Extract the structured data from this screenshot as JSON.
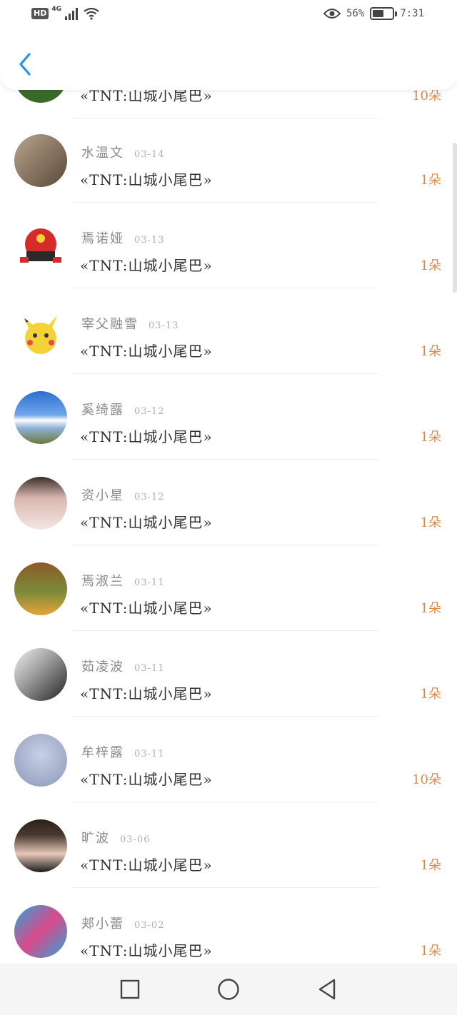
{
  "status_bar": {
    "hd": "HD",
    "network": "4G",
    "battery_pct": "56%",
    "battery_level": 0.56,
    "time": "7:31"
  },
  "nav": {
    "back_icon": "chevron-left-icon",
    "accent": "#2196f3"
  },
  "accent_count_color": "#e08a4a",
  "rows": [
    {
      "name": "",
      "date": "",
      "title": "«TNT:山城小尾巴»",
      "count": "10朵",
      "avatar_bg": "#3a6a2a"
    },
    {
      "name": "水温文",
      "date": "03-14",
      "title": "«TNT:山城小尾巴»",
      "count": "1朵",
      "avatar_bg": "#7a6a5a"
    },
    {
      "name": "焉诺娅",
      "date": "03-13",
      "title": "«TNT:山城小尾巴»",
      "count": "1朵",
      "avatar_bg": "#d62b2b"
    },
    {
      "name": "宰父融雪",
      "date": "03-13",
      "title": "«TNT:山城小尾巴»",
      "count": "1朵",
      "avatar_bg": "#f3d23a"
    },
    {
      "name": "奚绮露",
      "date": "03-12",
      "title": "«TNT:山城小尾巴»",
      "count": "1朵",
      "avatar_bg": "#3d78c9"
    },
    {
      "name": "资小星",
      "date": "03-12",
      "title": "«TNT:山城小尾巴»",
      "count": "1朵",
      "avatar_bg": "#d9b7b0"
    },
    {
      "name": "焉淑兰",
      "date": "03-11",
      "title": "«TNT:山城小尾巴»",
      "count": "1朵",
      "avatar_bg": "#7b8a3a"
    },
    {
      "name": "茹凌波",
      "date": "03-11",
      "title": "«TNT:山城小尾巴»",
      "count": "1朵",
      "avatar_bg": "#6a6a6a"
    },
    {
      "name": "牟梓露",
      "date": "03-11",
      "title": "«TNT:山城小尾巴»",
      "count": "10朵",
      "avatar_bg": "#9aa8c8"
    },
    {
      "name": "旷波",
      "date": "03-06",
      "title": "«TNT:山城小尾巴»",
      "count": "1朵",
      "avatar_bg": "#4a3a30"
    },
    {
      "name": "郏小蕾",
      "date": "03-02",
      "title": "«TNT:山城小尾巴»",
      "count": "1朵",
      "avatar_bg": "#2aa6d8"
    }
  ],
  "bottom_nav": {
    "recent_icon": "square-icon",
    "home_icon": "circle-icon",
    "back_icon": "triangle-back-icon"
  }
}
